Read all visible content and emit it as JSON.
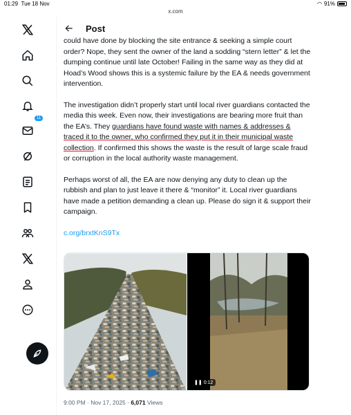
{
  "statusbar": {
    "time": "01:29",
    "date": "Tue 18 Nov",
    "battery": "91%",
    "battery_level": 0.91
  },
  "browser": {
    "url": "x.com"
  },
  "header": {
    "title": "Post"
  },
  "sidebar": {
    "notification_count": "11"
  },
  "post": {
    "p1": "could have done by blocking the site entrance & seeking a simple court order? Nope, they sent the owner of the land a sodding “stern letter” & let the dumping continue until late October! Failing in the same way as they did at Hoad’s Wood shows this is a systemic failure by the EA & needs government intervention.",
    "p2_a": "The investigation didn’t properly start until local river guardians contacted the media this week. Even now, their investigations are bearing more fruit than the EA’s. They ",
    "p2_u": "guardians have found waste with names & addresses & traced it to the owner, who confirmed they put it in their municipal waste collection",
    "p2_b": ". If confirmed this shows the waste is the result of large scale fraud or corruption in  the local authority waste management.",
    "p3": "Perhaps worst of all, the EA are now denying any duty to clean up the rubbish and plan to just leave it there & “monitor” it. Local river guardians have made a petition demanding a clean up. Please do sign it & support their campaign.",
    "link": "c.org/brxtKnS9Tx",
    "video_time": "0:12",
    "timestamp": "9:00 PM · Nov 17, 2025 · ",
    "views_count": "6,071",
    "views_label": " Views"
  }
}
